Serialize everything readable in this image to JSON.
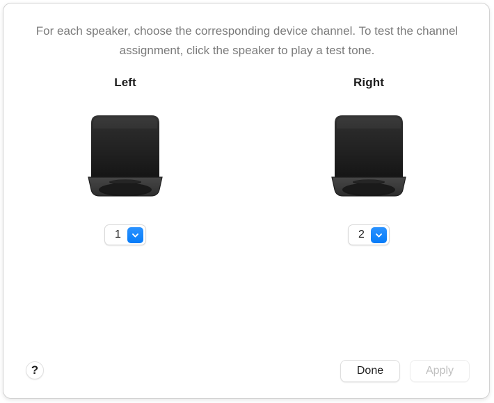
{
  "dialog": {
    "instructions": "For each speaker, choose the corresponding device channel. To test the channel assignment, click the speaker to play a test tone."
  },
  "speakers": [
    {
      "label": "Left",
      "speaker_name": "left-speaker",
      "channel_value": "1"
    },
    {
      "label": "Right",
      "speaker_name": "right-speaker",
      "channel_value": "2"
    }
  ],
  "footer": {
    "help_label": "?",
    "done_label": "Done",
    "apply_label": "Apply",
    "apply_enabled": false
  },
  "colors": {
    "accent_blue": "#1a8cff",
    "text_primary": "#1d1d1d",
    "text_secondary": "#7b7b7b",
    "text_disabled": "#bfbfbf",
    "speaker_body_top": "#2f2f2f",
    "speaker_body_bottom": "#141414",
    "speaker_base": "#3c3c3c",
    "window_bg": "#ffffff",
    "window_border": "#d2d2d2"
  }
}
